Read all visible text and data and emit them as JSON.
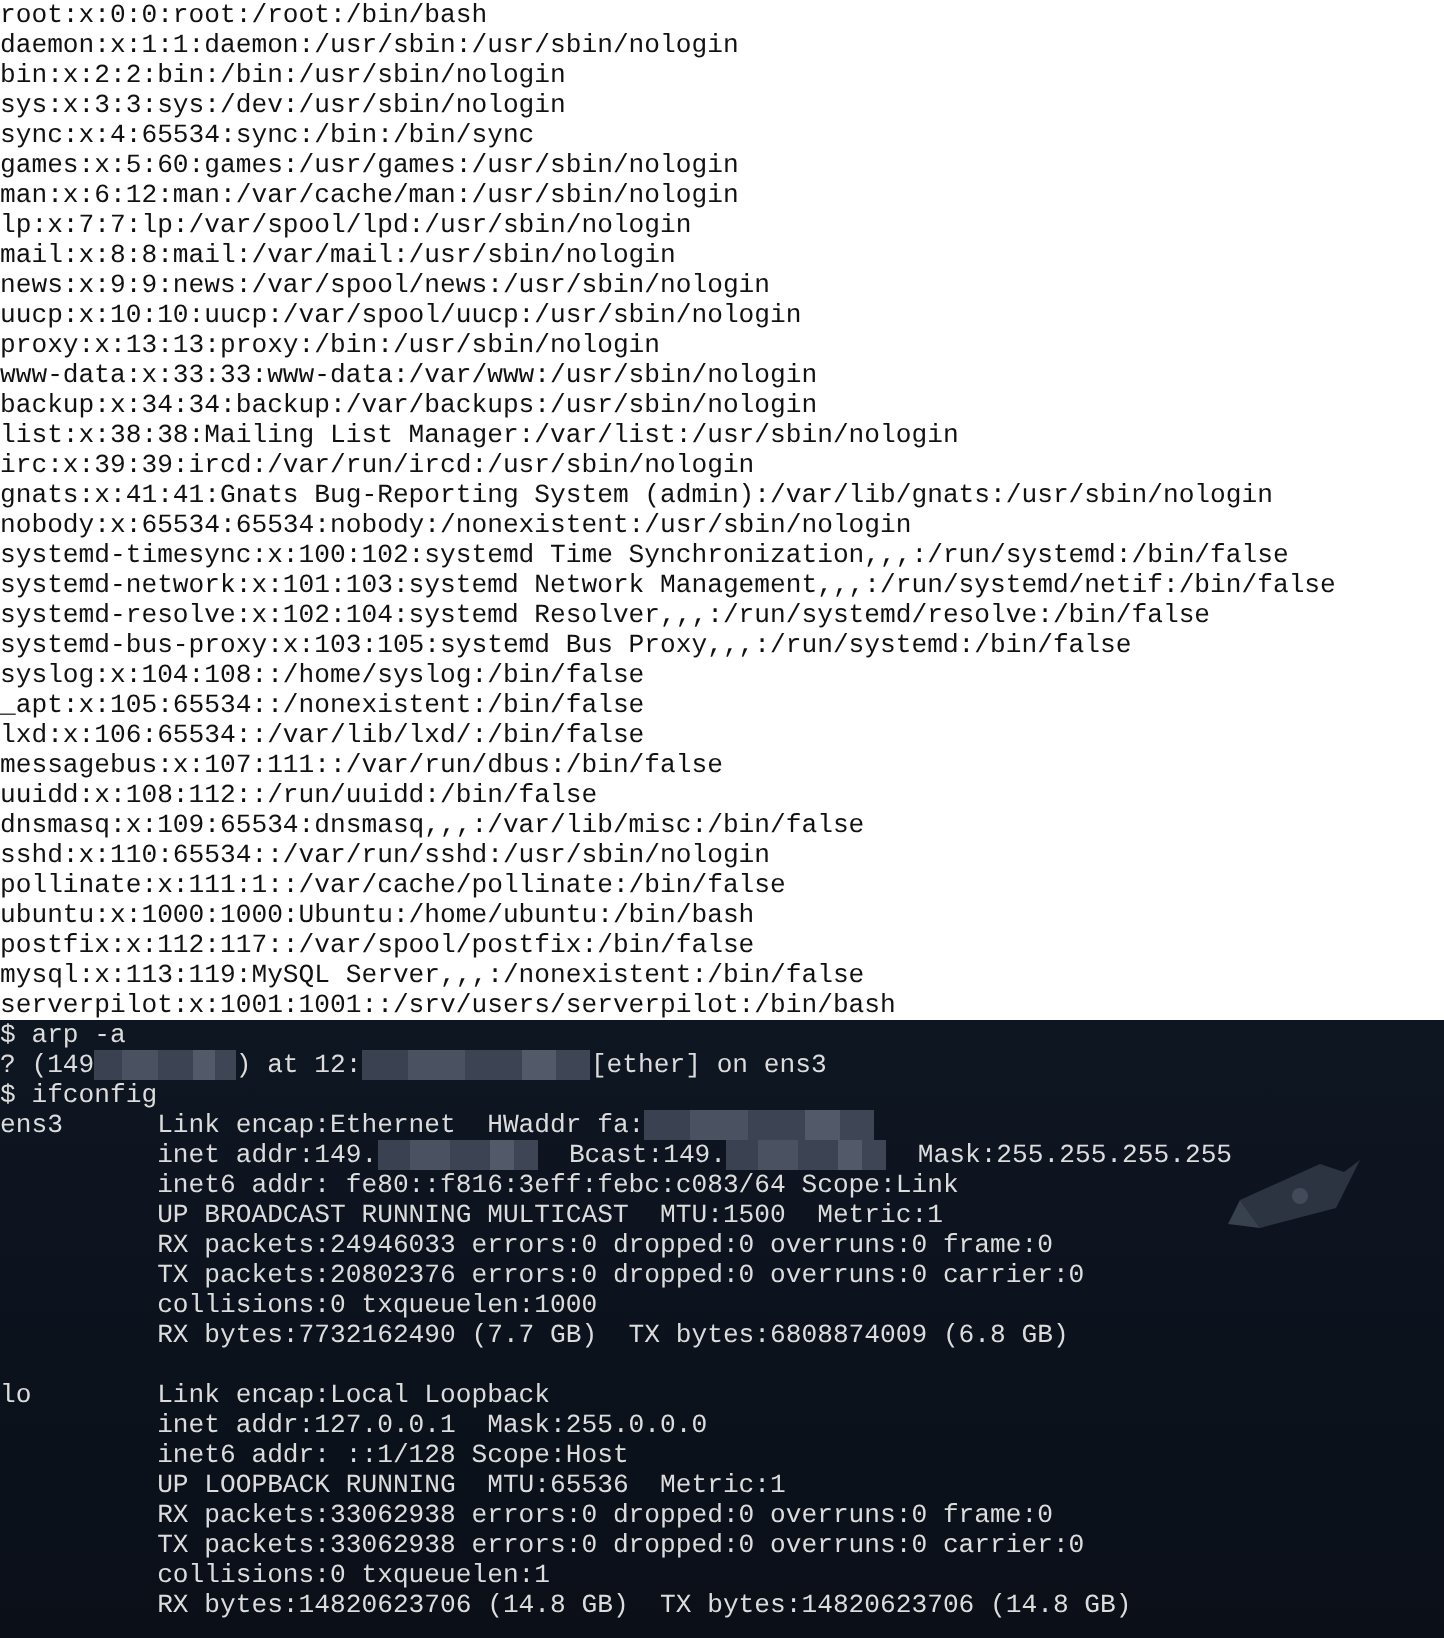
{
  "passwd_output": [
    "root:x:0:0:root:/root:/bin/bash",
    "daemon:x:1:1:daemon:/usr/sbin:/usr/sbin/nologin",
    "bin:x:2:2:bin:/bin:/usr/sbin/nologin",
    "sys:x:3:3:sys:/dev:/usr/sbin/nologin",
    "sync:x:4:65534:sync:/bin:/bin/sync",
    "games:x:5:60:games:/usr/games:/usr/sbin/nologin",
    "man:x:6:12:man:/var/cache/man:/usr/sbin/nologin",
    "lp:x:7:7:lp:/var/spool/lpd:/usr/sbin/nologin",
    "mail:x:8:8:mail:/var/mail:/usr/sbin/nologin",
    "news:x:9:9:news:/var/spool/news:/usr/sbin/nologin",
    "uucp:x:10:10:uucp:/var/spool/uucp:/usr/sbin/nologin",
    "proxy:x:13:13:proxy:/bin:/usr/sbin/nologin",
    "www-data:x:33:33:www-data:/var/www:/usr/sbin/nologin",
    "backup:x:34:34:backup:/var/backups:/usr/sbin/nologin",
    "list:x:38:38:Mailing List Manager:/var/list:/usr/sbin/nologin",
    "irc:x:39:39:ircd:/var/run/ircd:/usr/sbin/nologin",
    "gnats:x:41:41:Gnats Bug-Reporting System (admin):/var/lib/gnats:/usr/sbin/nologin",
    "nobody:x:65534:65534:nobody:/nonexistent:/usr/sbin/nologin",
    "systemd-timesync:x:100:102:systemd Time Synchronization,,,:/run/systemd:/bin/false",
    "systemd-network:x:101:103:systemd Network Management,,,:/run/systemd/netif:/bin/false",
    "systemd-resolve:x:102:104:systemd Resolver,,,:/run/systemd/resolve:/bin/false",
    "systemd-bus-proxy:x:103:105:systemd Bus Proxy,,,:/run/systemd:/bin/false",
    "syslog:x:104:108::/home/syslog:/bin/false",
    "_apt:x:105:65534::/nonexistent:/bin/false",
    "lxd:x:106:65534::/var/lib/lxd/:/bin/false",
    "messagebus:x:107:111::/var/run/dbus:/bin/false",
    "uuidd:x:108:112::/run/uuidd:/bin/false",
    "dnsmasq:x:109:65534:dnsmasq,,,:/var/lib/misc:/bin/false",
    "sshd:x:110:65534::/var/run/sshd:/usr/sbin/nologin",
    "pollinate:x:111:1::/var/cache/pollinate:/bin/false",
    "ubuntu:x:1000:1000:Ubuntu:/home/ubuntu:/bin/bash",
    "postfix:x:112:117::/var/spool/postfix:/bin/false",
    "mysql:x:113:119:MySQL Server,,,:/nonexistent:/bin/false",
    "serverpilot:x:1001:1001::/srv/users/serverpilot:/bin/bash"
  ],
  "terminal": {
    "lines": [
      {
        "kind": "text",
        "segments": [
          {
            "kind": "text",
            "text": "$ arp -a"
          }
        ]
      },
      {
        "kind": "text",
        "segments": [
          {
            "kind": "text",
            "text": "? (149"
          },
          {
            "kind": "redacted_short"
          },
          {
            "kind": "text",
            "text": ") at 12:"
          },
          {
            "kind": "redacted_long"
          },
          {
            "kind": "text",
            "text": "[ether] on ens3"
          }
        ]
      },
      {
        "kind": "text",
        "segments": [
          {
            "kind": "text",
            "text": "$ ifconfig"
          }
        ]
      },
      {
        "kind": "text",
        "segments": [
          {
            "kind": "text",
            "text": "ens3      Link encap:Ethernet  HWaddr fa:"
          },
          {
            "kind": "redacted_long"
          }
        ]
      },
      {
        "kind": "text",
        "segments": [
          {
            "kind": "text",
            "text": "          inet addr:149."
          },
          {
            "kind": "redacted_medium"
          },
          {
            "kind": "text",
            "text": "  Bcast:149."
          },
          {
            "kind": "redacted_medium"
          },
          {
            "kind": "text",
            "text": "  Mask:255.255.255.255"
          }
        ]
      },
      {
        "kind": "text",
        "segments": [
          {
            "kind": "text",
            "text": "          inet6 addr: fe80::f816:3eff:febc:c083/64 Scope:Link"
          }
        ]
      },
      {
        "kind": "text",
        "segments": [
          {
            "kind": "text",
            "text": "          UP BROADCAST RUNNING MULTICAST  MTU:1500  Metric:1"
          }
        ]
      },
      {
        "kind": "text",
        "segments": [
          {
            "kind": "text",
            "text": "          RX packets:24946033 errors:0 dropped:0 overruns:0 frame:0"
          }
        ]
      },
      {
        "kind": "text",
        "segments": [
          {
            "kind": "text",
            "text": "          TX packets:20802376 errors:0 dropped:0 overruns:0 carrier:0"
          }
        ]
      },
      {
        "kind": "text",
        "segments": [
          {
            "kind": "text",
            "text": "          collisions:0 txqueuelen:1000"
          }
        ]
      },
      {
        "kind": "text",
        "segments": [
          {
            "kind": "text",
            "text": "          RX bytes:7732162490 (7.7 GB)  TX bytes:6808874009 (6.8 GB)"
          }
        ]
      },
      {
        "kind": "blank"
      },
      {
        "kind": "text",
        "segments": [
          {
            "kind": "text",
            "text": "lo        Link encap:Local Loopback"
          }
        ]
      },
      {
        "kind": "text",
        "segments": [
          {
            "kind": "text",
            "text": "          inet addr:127.0.0.1  Mask:255.0.0.0"
          }
        ]
      },
      {
        "kind": "text",
        "segments": [
          {
            "kind": "text",
            "text": "          inet6 addr: ::1/128 Scope:Host"
          }
        ]
      },
      {
        "kind": "text",
        "segments": [
          {
            "kind": "text",
            "text": "          UP LOOPBACK RUNNING  MTU:65536  Metric:1"
          }
        ]
      },
      {
        "kind": "text",
        "segments": [
          {
            "kind": "text",
            "text": "          RX packets:33062938 errors:0 dropped:0 overruns:0 frame:0"
          }
        ]
      },
      {
        "kind": "text",
        "segments": [
          {
            "kind": "text",
            "text": "          TX packets:33062938 errors:0 dropped:0 overruns:0 carrier:0"
          }
        ]
      },
      {
        "kind": "text",
        "segments": [
          {
            "kind": "text",
            "text": "          collisions:0 txqueuelen:1"
          }
        ]
      },
      {
        "kind": "text",
        "segments": [
          {
            "kind": "text",
            "text": "          RX bytes:14820623706 (14.8 GB)  TX bytes:14820623706 (14.8 GB)"
          }
        ]
      }
    ]
  }
}
